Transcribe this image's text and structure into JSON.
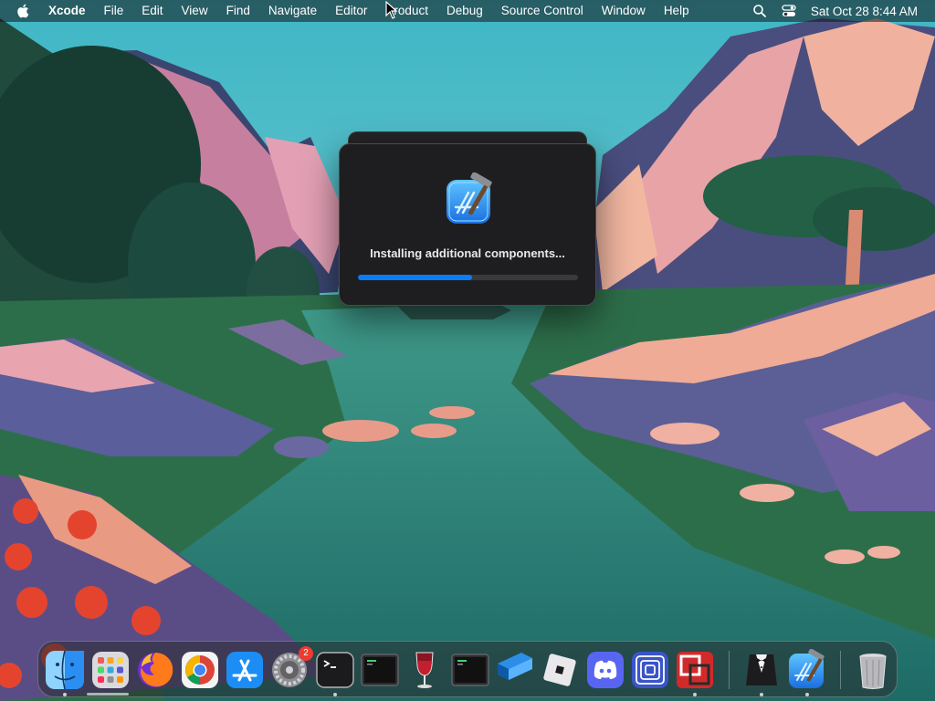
{
  "menubar": {
    "app_name": "Xcode",
    "menus": [
      "File",
      "Edit",
      "View",
      "Find",
      "Navigate",
      "Editor",
      "Product",
      "Debug",
      "Source Control",
      "Window",
      "Help"
    ],
    "clock": "Sat Oct 28  8:44 AM",
    "icons": [
      "apple-icon",
      "spotlight-search-icon",
      "control-center-icon"
    ]
  },
  "dialog": {
    "message": "Installing additional components...",
    "progress": 0.52,
    "icon": "xcode-icon",
    "colors": {
      "progress_fill": "#0a7cf5",
      "progress_track": "#3a3a3c"
    }
  },
  "dock": {
    "items": [
      {
        "name": "finder",
        "icon": "finder-icon",
        "running": true
      },
      {
        "name": "launchpad",
        "icon": "launchpad-icon",
        "running": false
      },
      {
        "name": "firefox",
        "icon": "firefox-icon",
        "running": false
      },
      {
        "name": "chrome",
        "icon": "chrome-icon",
        "running": false
      },
      {
        "name": "app-store",
        "icon": "app-store-icon",
        "running": false
      },
      {
        "name": "system-settings",
        "icon": "settings-icon",
        "running": false,
        "badge": "2"
      },
      {
        "name": "terminal",
        "icon": "terminal-icon",
        "running": true
      },
      {
        "name": "console-1",
        "icon": "console-icon",
        "running": false
      },
      {
        "name": "wine",
        "icon": "wine-icon",
        "running": false
      },
      {
        "name": "console-2",
        "icon": "console-icon",
        "running": false
      },
      {
        "name": "sourcetree",
        "icon": "sourcetree-icon",
        "running": false
      },
      {
        "name": "roblox",
        "icon": "roblox-icon",
        "running": false
      },
      {
        "name": "discord",
        "icon": "discord-icon",
        "running": false
      },
      {
        "name": "network-tool",
        "icon": "concentric-squares-icon",
        "running": false
      },
      {
        "name": "parallels",
        "icon": "parallels-icon",
        "running": true
      },
      {
        "name": "bartender",
        "icon": "tuxedo-icon",
        "running": true
      },
      {
        "name": "xcode",
        "icon": "xcode-icon",
        "running": true
      },
      {
        "name": "trash",
        "icon": "trash-icon",
        "running": false
      }
    ]
  }
}
